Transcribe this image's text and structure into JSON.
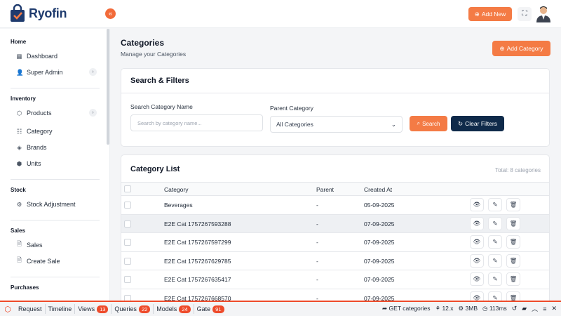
{
  "brand": {
    "name": "Ryofin",
    "accent": "#f47b45",
    "navy": "#0f2a4a"
  },
  "header": {
    "add_new_label": "Add New"
  },
  "sidebar": {
    "sections": [
      {
        "title": "Home",
        "items": [
          {
            "label": "Dashboard",
            "icon": "grid-icon"
          },
          {
            "label": "Super Admin",
            "icon": "user-icon",
            "expandable": true
          }
        ]
      },
      {
        "title": "Inventory",
        "items": [
          {
            "label": "Products",
            "icon": "box-icon",
            "expandable": true
          },
          {
            "label": "Category",
            "icon": "category-icon"
          },
          {
            "label": "Brands",
            "icon": "tag-icon"
          },
          {
            "label": "Units",
            "icon": "cube-icon"
          }
        ]
      },
      {
        "title": "Stock",
        "items": [
          {
            "label": "Stock Adjustment",
            "icon": "adjust-icon"
          }
        ]
      },
      {
        "title": "Sales",
        "items": [
          {
            "label": "Sales",
            "icon": "document-icon"
          },
          {
            "label": "Create Sale",
            "icon": "document-icon"
          }
        ]
      },
      {
        "title": "Purchases",
        "items": []
      }
    ]
  },
  "page": {
    "title": "Categories",
    "subtitle": "Manage your Categories",
    "add_button": "Add Category"
  },
  "filters": {
    "title": "Search & Filters",
    "name_label": "Search Category Name",
    "name_placeholder": "Search by category name...",
    "parent_label": "Parent Category",
    "parent_value": "All Categories",
    "search_button": "Search",
    "clear_button": "Clear Filters"
  },
  "list": {
    "title": "Category List",
    "total": "Total: 8 categories",
    "columns": [
      "Category",
      "Parent",
      "Created At"
    ],
    "rows": [
      {
        "category": "Beverages",
        "parent": "-",
        "created": "05-09-2025"
      },
      {
        "category": "E2E Cat 1757267593288",
        "parent": "-",
        "created": "07-09-2025"
      },
      {
        "category": "E2E Cat 1757267597299",
        "parent": "-",
        "created": "07-09-2025"
      },
      {
        "category": "E2E Cat 1757267629785",
        "parent": "-",
        "created": "07-09-2025"
      },
      {
        "category": "E2E Cat 1757267635417",
        "parent": "-",
        "created": "07-09-2025"
      },
      {
        "category": "E2E Cat 1757267668570",
        "parent": "-",
        "created": "07-09-2025"
      }
    ]
  },
  "debugbar": {
    "tabs": [
      {
        "label": "Request"
      },
      {
        "label": "Timeline"
      },
      {
        "label": "Views",
        "count": "13"
      },
      {
        "label": "Queries",
        "count": "22"
      },
      {
        "label": "Models",
        "count": "24"
      },
      {
        "label": "Gate",
        "count": "91"
      }
    ],
    "route": "GET categories",
    "version": "12.x",
    "memory": "3MB",
    "time": "113ms"
  }
}
